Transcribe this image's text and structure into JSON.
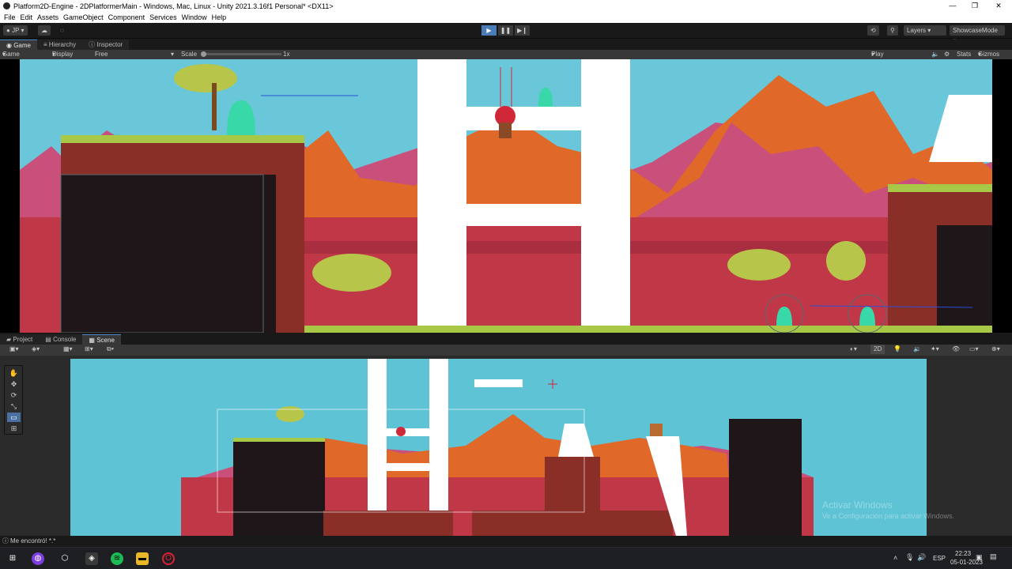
{
  "window": {
    "title": "Platform2D-Engine - 2DPlatformerMain - Windows, Mac, Linux - Unity 2021.3.16f1 Personal* <DX11>"
  },
  "menu": [
    "File",
    "Edit",
    "Assets",
    "GameObject",
    "Component",
    "Services",
    "Window",
    "Help"
  ],
  "toolbar": {
    "account": "JP",
    "layers": "Layers",
    "layout": "ShowcaseMode"
  },
  "top_tabs": [
    "Game",
    "Hierarchy",
    "Inspector"
  ],
  "game_controls": {
    "mode": "Game",
    "display": "Display 1",
    "aspect": "Free Aspect",
    "scale_label": "Scale",
    "scale_value": "1x",
    "play_focus": "Play Focused",
    "stats": "Stats",
    "gizmos": "Gizmos"
  },
  "bottom_tabs": [
    "Project",
    "Console",
    "Scene"
  ],
  "scene_controls": {
    "mode_2d": "2D"
  },
  "status": {
    "message": "Me encontró! *.*"
  },
  "watermark": {
    "line1": "Activar Windows",
    "line2": "Ve a Configuración para activar Windows."
  },
  "taskbar": {
    "lang": "ESP",
    "time": "22:23",
    "date": "05-01-2023"
  },
  "colors": {
    "accent": "#4a7cb8",
    "sky": "#69c7d9",
    "pink": "#c9507a",
    "orange": "#e06828",
    "red": "#c03848",
    "grass": "#a8c848",
    "dark": "#1e1618"
  }
}
